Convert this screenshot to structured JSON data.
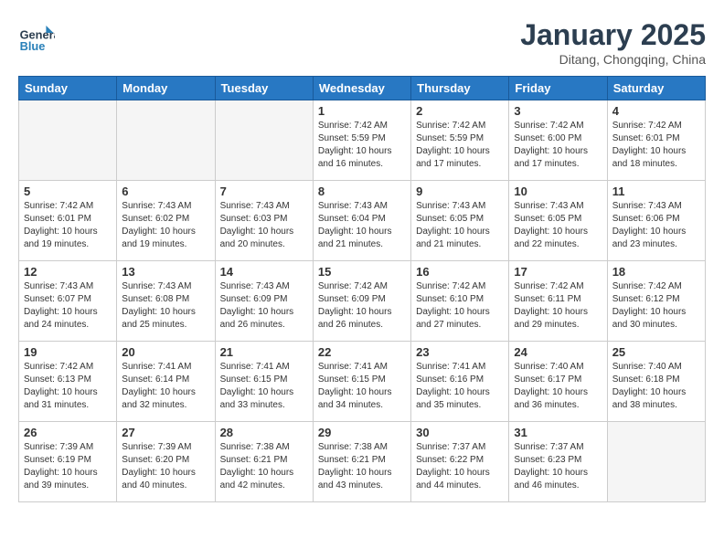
{
  "header": {
    "logo_line1": "General",
    "logo_line2": "Blue",
    "month": "January 2025",
    "location": "Ditang, Chongqing, China"
  },
  "weekdays": [
    "Sunday",
    "Monday",
    "Tuesday",
    "Wednesday",
    "Thursday",
    "Friday",
    "Saturday"
  ],
  "weeks": [
    [
      {
        "day": "",
        "empty": true
      },
      {
        "day": "",
        "empty": true
      },
      {
        "day": "",
        "empty": true
      },
      {
        "day": "1",
        "sunrise": "7:42 AM",
        "sunset": "5:59 PM",
        "daylight": "10 hours and 16 minutes."
      },
      {
        "day": "2",
        "sunrise": "7:42 AM",
        "sunset": "5:59 PM",
        "daylight": "10 hours and 17 minutes."
      },
      {
        "day": "3",
        "sunrise": "7:42 AM",
        "sunset": "6:00 PM",
        "daylight": "10 hours and 17 minutes."
      },
      {
        "day": "4",
        "sunrise": "7:42 AM",
        "sunset": "6:01 PM",
        "daylight": "10 hours and 18 minutes."
      }
    ],
    [
      {
        "day": "5",
        "sunrise": "7:42 AM",
        "sunset": "6:01 PM",
        "daylight": "10 hours and 19 minutes."
      },
      {
        "day": "6",
        "sunrise": "7:43 AM",
        "sunset": "6:02 PM",
        "daylight": "10 hours and 19 minutes."
      },
      {
        "day": "7",
        "sunrise": "7:43 AM",
        "sunset": "6:03 PM",
        "daylight": "10 hours and 20 minutes."
      },
      {
        "day": "8",
        "sunrise": "7:43 AM",
        "sunset": "6:04 PM",
        "daylight": "10 hours and 21 minutes."
      },
      {
        "day": "9",
        "sunrise": "7:43 AM",
        "sunset": "6:05 PM",
        "daylight": "10 hours and 21 minutes."
      },
      {
        "day": "10",
        "sunrise": "7:43 AM",
        "sunset": "6:05 PM",
        "daylight": "10 hours and 22 minutes."
      },
      {
        "day": "11",
        "sunrise": "7:43 AM",
        "sunset": "6:06 PM",
        "daylight": "10 hours and 23 minutes."
      }
    ],
    [
      {
        "day": "12",
        "sunrise": "7:43 AM",
        "sunset": "6:07 PM",
        "daylight": "10 hours and 24 minutes."
      },
      {
        "day": "13",
        "sunrise": "7:43 AM",
        "sunset": "6:08 PM",
        "daylight": "10 hours and 25 minutes."
      },
      {
        "day": "14",
        "sunrise": "7:43 AM",
        "sunset": "6:09 PM",
        "daylight": "10 hours and 26 minutes."
      },
      {
        "day": "15",
        "sunrise": "7:42 AM",
        "sunset": "6:09 PM",
        "daylight": "10 hours and 26 minutes."
      },
      {
        "day": "16",
        "sunrise": "7:42 AM",
        "sunset": "6:10 PM",
        "daylight": "10 hours and 27 minutes."
      },
      {
        "day": "17",
        "sunrise": "7:42 AM",
        "sunset": "6:11 PM",
        "daylight": "10 hours and 29 minutes."
      },
      {
        "day": "18",
        "sunrise": "7:42 AM",
        "sunset": "6:12 PM",
        "daylight": "10 hours and 30 minutes."
      }
    ],
    [
      {
        "day": "19",
        "sunrise": "7:42 AM",
        "sunset": "6:13 PM",
        "daylight": "10 hours and 31 minutes."
      },
      {
        "day": "20",
        "sunrise": "7:41 AM",
        "sunset": "6:14 PM",
        "daylight": "10 hours and 32 minutes."
      },
      {
        "day": "21",
        "sunrise": "7:41 AM",
        "sunset": "6:15 PM",
        "daylight": "10 hours and 33 minutes."
      },
      {
        "day": "22",
        "sunrise": "7:41 AM",
        "sunset": "6:15 PM",
        "daylight": "10 hours and 34 minutes."
      },
      {
        "day": "23",
        "sunrise": "7:41 AM",
        "sunset": "6:16 PM",
        "daylight": "10 hours and 35 minutes."
      },
      {
        "day": "24",
        "sunrise": "7:40 AM",
        "sunset": "6:17 PM",
        "daylight": "10 hours and 36 minutes."
      },
      {
        "day": "25",
        "sunrise": "7:40 AM",
        "sunset": "6:18 PM",
        "daylight": "10 hours and 38 minutes."
      }
    ],
    [
      {
        "day": "26",
        "sunrise": "7:39 AM",
        "sunset": "6:19 PM",
        "daylight": "10 hours and 39 minutes."
      },
      {
        "day": "27",
        "sunrise": "7:39 AM",
        "sunset": "6:20 PM",
        "daylight": "10 hours and 40 minutes."
      },
      {
        "day": "28",
        "sunrise": "7:38 AM",
        "sunset": "6:21 PM",
        "daylight": "10 hours and 42 minutes."
      },
      {
        "day": "29",
        "sunrise": "7:38 AM",
        "sunset": "6:21 PM",
        "daylight": "10 hours and 43 minutes."
      },
      {
        "day": "30",
        "sunrise": "7:37 AM",
        "sunset": "6:22 PM",
        "daylight": "10 hours and 44 minutes."
      },
      {
        "day": "31",
        "sunrise": "7:37 AM",
        "sunset": "6:23 PM",
        "daylight": "10 hours and 46 minutes."
      },
      {
        "day": "",
        "empty": true
      }
    ]
  ]
}
